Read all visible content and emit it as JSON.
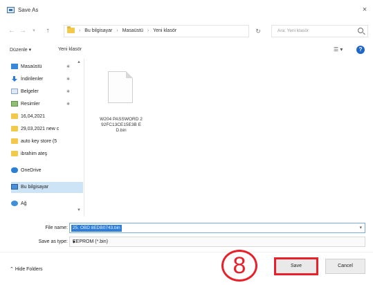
{
  "window": {
    "title": "Save As",
    "close_label": "×"
  },
  "address": {
    "crumbs": [
      "Bu bilgisayar",
      "Masaüstü",
      "Yeni klasör"
    ],
    "search_placeholder": "Ara: Yeni klasör"
  },
  "toolbar": {
    "organize_label": "Düzenle ▾",
    "new_folder_label": "Yeni klasör"
  },
  "nav": {
    "items": [
      {
        "label": "Masaüstü",
        "icon": "desktop-icon",
        "pinned": true
      },
      {
        "label": "İndirilenler",
        "icon": "download-icon",
        "pinned": true
      },
      {
        "label": "Belgeler",
        "icon": "documents-icon",
        "pinned": true
      },
      {
        "label": "Resimler",
        "icon": "pictures-icon",
        "pinned": true
      },
      {
        "label": "16,04,2021",
        "icon": "folder-icon",
        "pinned": false
      },
      {
        "label": "29,03,2021 new c",
        "icon": "folder-icon",
        "pinned": false
      },
      {
        "label": "auto key store (5",
        "icon": "folder-icon",
        "pinned": false
      },
      {
        "label": "ibrahim ateş",
        "icon": "folder-icon",
        "pinned": false
      },
      {
        "label": "OneDrive",
        "icon": "onedrive-icon",
        "pinned": false
      },
      {
        "label": "Bu bilgisayar",
        "icon": "pc-icon",
        "pinned": false,
        "selected": true
      },
      {
        "label": "Ağ",
        "icon": "network-icon",
        "pinned": false
      }
    ]
  },
  "files": [
    {
      "name": "W204 PASSWORD 292FC13CE15E3B ED.bin"
    }
  ],
  "bottom": {
    "filename_label": "File name:",
    "filename_value": "25. OBD 8EDB0743.bin",
    "savetype_label": "Save as type:",
    "savetype_value": "EEPROM (*.bin)",
    "hide_folders_label": "Hide Folders",
    "save_label": "Save",
    "cancel_label": "Cancel",
    "step_number": "8"
  },
  "colors": {
    "accent": "#e8202a",
    "selection": "#2f7ed8",
    "help": "#1e66c8"
  }
}
